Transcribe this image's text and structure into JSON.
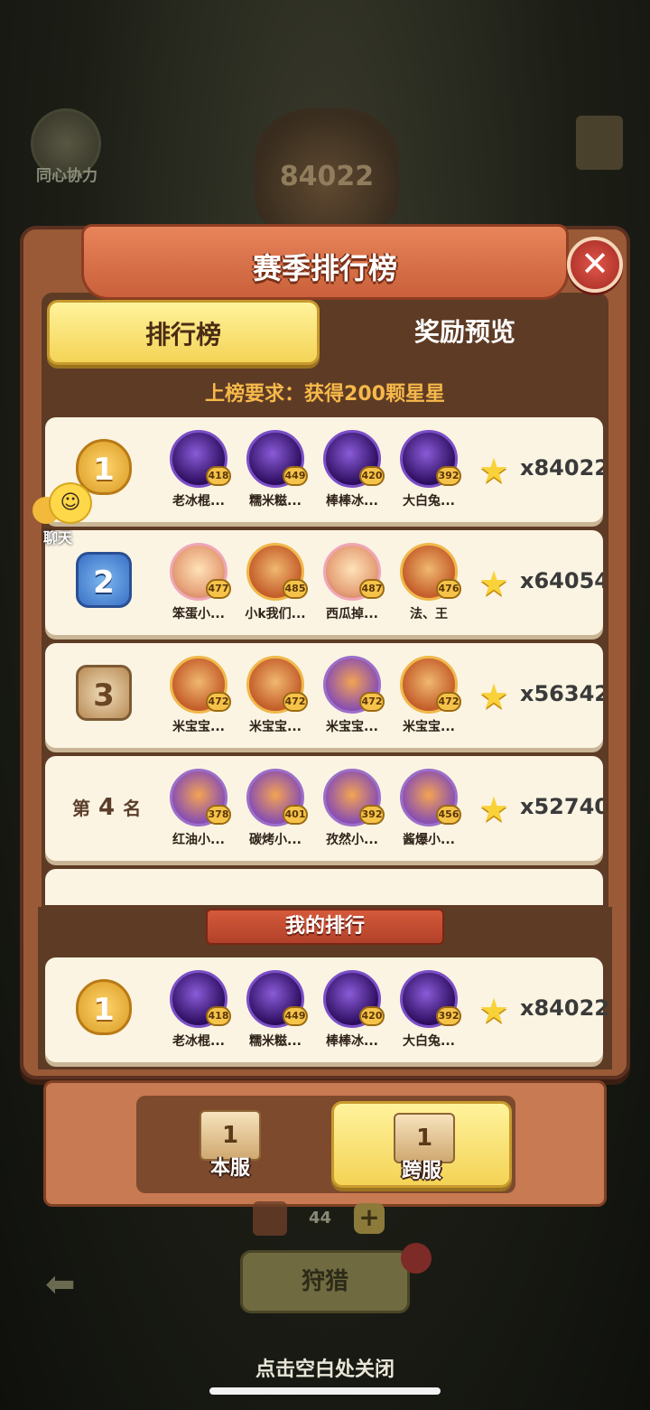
{
  "background": {
    "event_label": "同心协力",
    "badge_value": "84022"
  },
  "dialog": {
    "title": "赛季排行榜",
    "close_icon": "close-icon"
  },
  "tabs": [
    {
      "label": "排行榜",
      "active": true
    },
    {
      "label": "奖励预览",
      "active": false
    }
  ],
  "requirement": "上榜要求：获得200颗星星",
  "chat": {
    "label": "聊天"
  },
  "rows": [
    {
      "rank": "1",
      "rank_style": "gold",
      "members": [
        {
          "name": "老冰棍...",
          "level": "418",
          "color": "purple"
        },
        {
          "name": "糯米糍...",
          "level": "449",
          "color": "purple"
        },
        {
          "name": "棒棒冰...",
          "level": "420",
          "color": "purple"
        },
        {
          "name": "大白兔...",
          "level": "392",
          "color": "purple"
        }
      ],
      "score": "x84022"
    },
    {
      "rank": "2",
      "rank_style": "silver",
      "members": [
        {
          "name": "笨蛋小...",
          "level": "477",
          "color": "pink"
        },
        {
          "name": "小k我们...",
          "level": "485",
          "color": "orange"
        },
        {
          "name": "西瓜掉...",
          "level": "487",
          "color": "pink"
        },
        {
          "name": "法、王",
          "level": "476",
          "color": "orange"
        }
      ],
      "score": "x64054"
    },
    {
      "rank": "3",
      "rank_style": "bronze",
      "members": [
        {
          "name": "米宝宝...",
          "level": "472",
          "color": "orange"
        },
        {
          "name": "米宝宝...",
          "level": "472",
          "color": "orange"
        },
        {
          "name": "米宝宝...",
          "level": "472",
          "color": "violet"
        },
        {
          "name": "米宝宝...",
          "level": "472",
          "color": "orange"
        }
      ],
      "score": "x56342"
    },
    {
      "rank_label_prefix": "第",
      "rank": "4",
      "rank_label_suffix": "名",
      "rank_style": "text",
      "members": [
        {
          "name": "红油小...",
          "level": "378",
          "color": "violet"
        },
        {
          "name": "碳烤小...",
          "level": "401",
          "color": "violet"
        },
        {
          "name": "孜然小...",
          "level": "392",
          "color": "violet"
        },
        {
          "name": "酱爆小...",
          "level": "456",
          "color": "violet"
        }
      ],
      "score": "x52740"
    }
  ],
  "my_rank": {
    "banner": "我的排行",
    "rank": "1",
    "members": [
      {
        "name": "老冰棍...",
        "level": "418",
        "color": "purple"
      },
      {
        "name": "糯米糍...",
        "level": "449",
        "color": "purple"
      },
      {
        "name": "棒棒冰...",
        "level": "420",
        "color": "purple"
      },
      {
        "name": "大白兔...",
        "level": "392",
        "color": "purple"
      }
    ],
    "score": "x84022"
  },
  "server_switch": {
    "local": {
      "label": "本服",
      "podium": "1"
    },
    "cross": {
      "label": "跨服",
      "podium": "1",
      "active": true
    }
  },
  "footer": {
    "counter": "44",
    "plus": "+",
    "hunt_label": "狩猎",
    "close_hint": "点击空白处关闭"
  },
  "colors": {
    "panel": "#9a5a37",
    "active_tab": "#f4d356",
    "row_bg": "#fbf4e3",
    "requirement": "#f6b94a"
  }
}
